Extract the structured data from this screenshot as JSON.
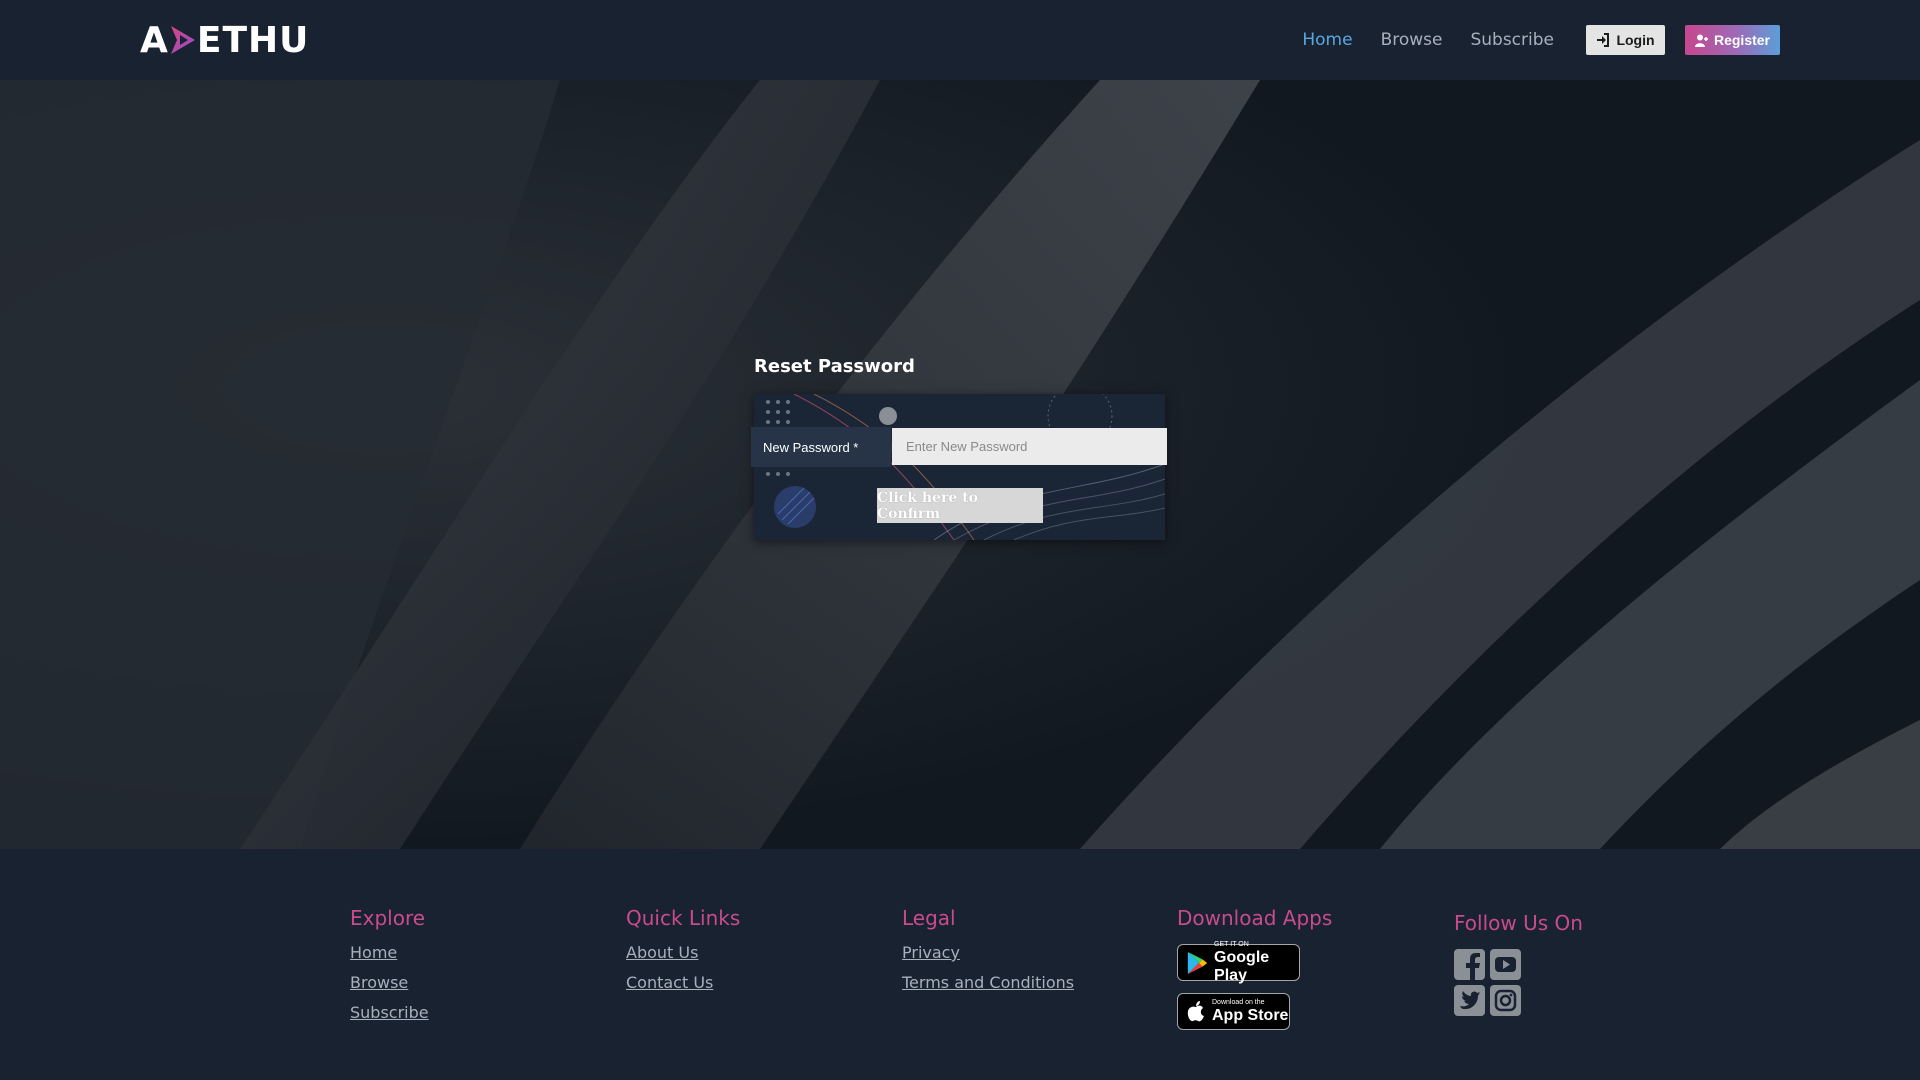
{
  "header": {
    "logo_text_left": "A",
    "logo_text_right": "ETHU",
    "nav": [
      {
        "label": "Home",
        "active": true
      },
      {
        "label": "Browse",
        "active": false
      },
      {
        "label": "Subscribe",
        "active": false
      }
    ],
    "login_label": "Login",
    "register_label": "Register",
    "active_color": "#5aa7e0"
  },
  "reset": {
    "title": "Reset Password",
    "field_label": "New Password *",
    "field_placeholder": "Enter New Password",
    "confirm_label": "Click here to Confirm"
  },
  "footer": {
    "explore": {
      "title": "Explore",
      "links": [
        "Home",
        "Browse",
        "Subscribe"
      ]
    },
    "quick_links": {
      "title": "Quick Links",
      "links": [
        "About Us",
        "Contact Us"
      ]
    },
    "legal": {
      "title": "Legal",
      "links": [
        "Privacy",
        "Terms and Conditions"
      ]
    },
    "apps": {
      "title": "Download Apps",
      "google_small": "GET IT ON",
      "google_big": "Google Play",
      "apple_small": "Download on the",
      "apple_big": "App Store"
    },
    "follow": {
      "title": "Follow Us On",
      "icons": [
        "facebook-icon",
        "youtube-icon",
        "twitter-icon",
        "instagram-icon"
      ]
    },
    "heading_color": "#c94b8a"
  }
}
